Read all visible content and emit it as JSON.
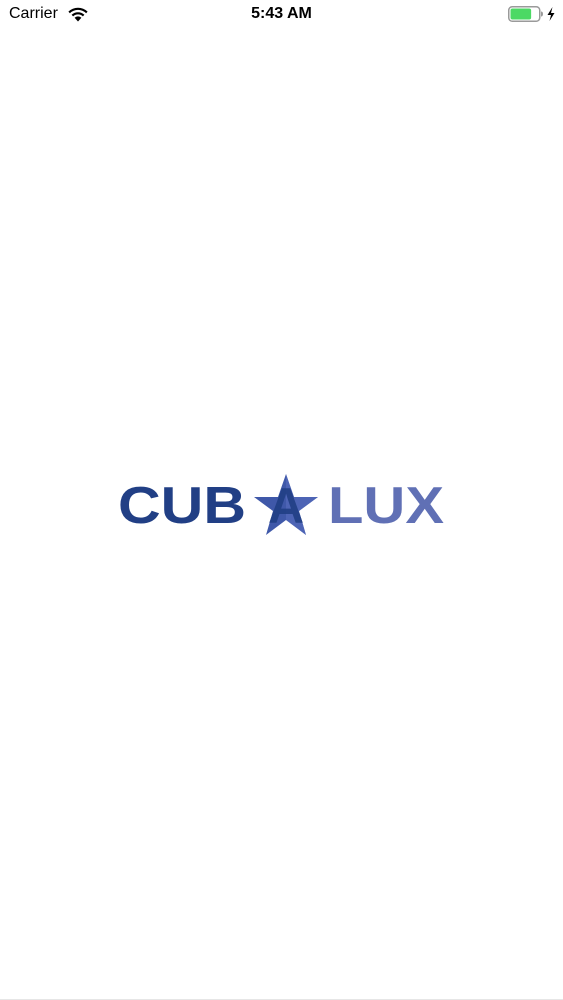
{
  "status_bar": {
    "carrier": "Carrier",
    "time": "5:43 AM",
    "wifi_icon": "wifi-icon",
    "battery_icon": "battery-icon",
    "battery_level": 0.75,
    "charging_icon": "bolt-icon",
    "battery_color": "#4cd964"
  },
  "splash": {
    "logo_left_text": "CUB",
    "logo_star_letter": "A",
    "logo_right_text": "LUX",
    "logo_star_icon": "star-icon",
    "colors": {
      "dark_blue": "#213f85",
      "light_blue": "#6070b5",
      "star_blue": "#3f58a9"
    }
  }
}
